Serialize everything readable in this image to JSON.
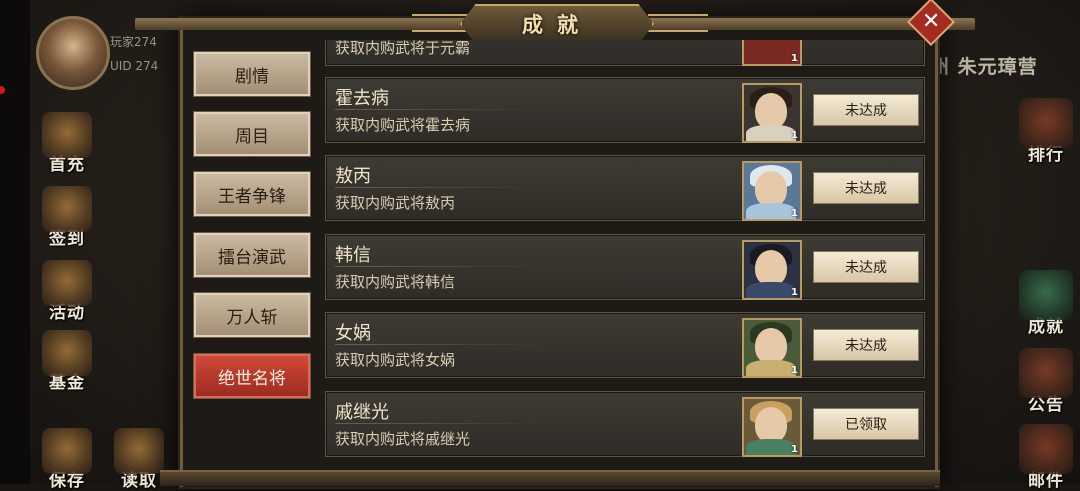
{
  "dialog": {
    "title": "成就",
    "close_icon": "close-icon"
  },
  "player": {
    "name": "玩家274",
    "uid": "UID 274"
  },
  "left_buttons": [
    {
      "label": "首充",
      "icon": "first-charge-icon"
    },
    {
      "label": "签到",
      "icon": "checkin-icon"
    },
    {
      "label": "活动",
      "icon": "activity-icon"
    },
    {
      "label": "基金",
      "icon": "fund-icon"
    },
    {
      "label": "保存",
      "icon": "save-icon"
    },
    {
      "label": "读取",
      "icon": "load-icon"
    }
  ],
  "right_panel": {
    "banner": "州 朱元璋营",
    "buttons": [
      {
        "label": "排行",
        "icon": "ranking-icon"
      },
      {
        "label": "成就",
        "icon": "achievement-icon"
      },
      {
        "label": "公告",
        "icon": "notice-icon"
      },
      {
        "label": "邮件",
        "icon": "mail-icon"
      }
    ]
  },
  "tabs": [
    "剧情",
    "周目",
    "王者争锋",
    "擂台演武",
    "万人斩",
    "绝世名将"
  ],
  "active_tab": "绝世名将",
  "partial_row": {
    "desc": "获取内购武将于元霸",
    "count": "1"
  },
  "achievements": [
    {
      "name": "霍去病",
      "desc": "获取内购武将霍去病",
      "count": "1",
      "status": "未达成"
    },
    {
      "name": "敖丙",
      "desc": "获取内购武将敖丙",
      "count": "1",
      "status": "未达成"
    },
    {
      "name": "韩信",
      "desc": "获取内购武将韩信",
      "count": "1",
      "status": "未达成"
    },
    {
      "name": "女娲",
      "desc": "获取内购武将女娲",
      "count": "1",
      "status": "未达成"
    },
    {
      "name": "戚继光",
      "desc": "获取内购武将戚继光",
      "count": "1",
      "status": "已领取"
    }
  ]
}
